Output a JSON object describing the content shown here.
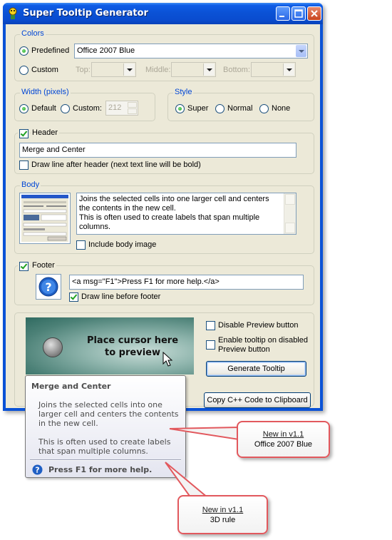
{
  "window": {
    "title": "Super Tooltip Generator"
  },
  "colors": {
    "legend": "Colors",
    "predefined_label": "Predefined",
    "predefined_selected": true,
    "predefined_value": "Office 2007 Blue",
    "custom_label": "Custom",
    "top_label": "Top:",
    "middle_label": "Middle:",
    "bottom_label": "Bottom:"
  },
  "width": {
    "legend": "Width (pixels)",
    "default_label": "Default",
    "custom_label": "Custom:",
    "custom_value": "212"
  },
  "style": {
    "legend": "Style",
    "super_label": "Super",
    "normal_label": "Normal",
    "none_label": "None",
    "selected": "Super"
  },
  "header": {
    "checkbox_label": "Header",
    "checked": true,
    "text": "Merge and Center",
    "draw_line_label": "Draw line after header (next text line will be bold)",
    "draw_line_checked": false
  },
  "body": {
    "legend": "Body",
    "text": "Joins the selected cells into one larger cell and centers the contents in the new cell.\nThis is often used to create labels that span multiple columns.",
    "include_image_label": "Include body image",
    "include_image_checked": false
  },
  "footer": {
    "checkbox_label": "Footer",
    "checked": true,
    "text": "<a msg=\"F1\">Press F1 for more help.</a>",
    "draw_line_label": "Draw line before footer",
    "draw_line_checked": true
  },
  "preview": {
    "text": "Place cursor here\nto preview",
    "disable_preview_label": "Disable Preview button",
    "enable_disabled_label": "Enable tooltip on disabled\nPreview button",
    "generate_button": "Generate Tooltip",
    "copy_button": "Copy C++ Code to Clipboard"
  },
  "tooltip": {
    "header": "Merge and Center",
    "body_line1": "Joins the selected cells into one larger cell and centers the contents in the new cell.",
    "body_line2": "This is often used to create labels that span multiple columns.",
    "footer": "Press F1 for more help."
  },
  "callouts": [
    {
      "new_label": "New in v1.1",
      "text": "Office 2007 Blue"
    },
    {
      "new_label": "New in v1.1",
      "text": "3D rule"
    }
  ],
  "colors_theme": {
    "titlebar": "#0a52d6",
    "dialog_bg": "#ece9d8",
    "group_label": "#0046d5",
    "callout_border": "#e2585d"
  }
}
